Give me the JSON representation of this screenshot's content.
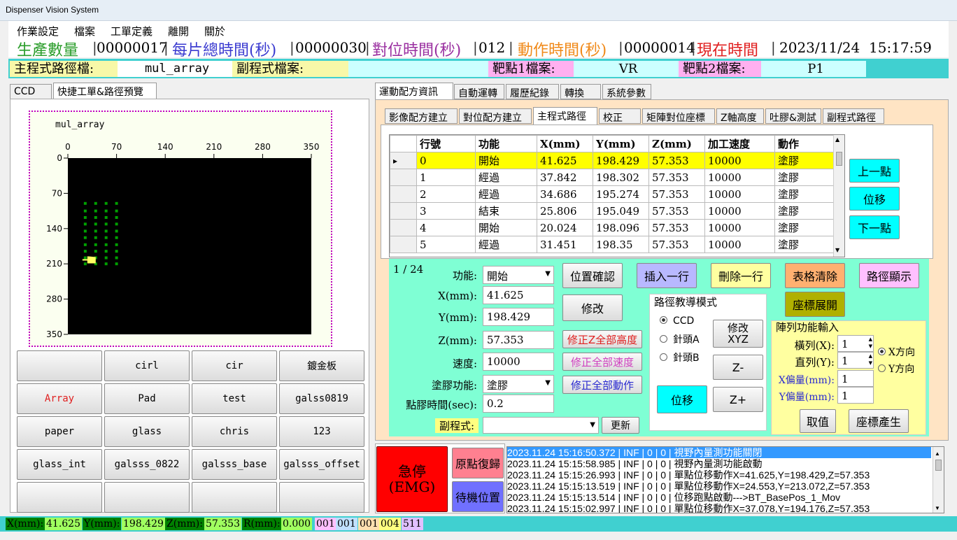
{
  "window": {
    "title": "Dispenser Vision System"
  },
  "menu": [
    "作業設定",
    "檔案",
    "工單定義",
    "離開",
    "關於"
  ],
  "info": {
    "prod_label": "生產數量",
    "prod_value": "00000017",
    "total_label": "每片總時間(秒)",
    "total_value": "00000030",
    "align_label": "對位時間(秒)",
    "align_value": "012",
    "action_label": "動作時間(秒)",
    "action_value": "00000014",
    "now_label": "現在時間",
    "now_value": "2023/11/24  15:17:59"
  },
  "paths": {
    "main_label": "主程式路徑檔:",
    "main_value": "mul_array",
    "sub_label": "副程式檔案:",
    "sub_value": "",
    "t1_label": "靶點1檔案:",
    "t1_value": "VR",
    "t2_label": "靶點2檔案:",
    "t2_value": "P1"
  },
  "left_tabs": [
    "CCD",
    "快捷工單&路徑預覽"
  ],
  "chart_data": {
    "type": "scatter",
    "title": "mul_array",
    "x_ticks": [
      "0",
      "70",
      "140",
      "210",
      "280",
      "350"
    ],
    "y_ticks": [
      "0",
      "70",
      "140",
      "210",
      "280",
      "350"
    ],
    "xlim": [
      0,
      350
    ],
    "ylim": [
      0,
      350
    ],
    "background": "#000000",
    "point_color": "#00a000",
    "points": [
      [
        25,
        90
      ],
      [
        40,
        90
      ],
      [
        55,
        90
      ],
      [
        70,
        90
      ],
      [
        25,
        105
      ],
      [
        40,
        105
      ],
      [
        55,
        105
      ],
      [
        70,
        105
      ],
      [
        25,
        118
      ],
      [
        40,
        118
      ],
      [
        55,
        118
      ],
      [
        70,
        118
      ],
      [
        25,
        131
      ],
      [
        40,
        131
      ],
      [
        55,
        131
      ],
      [
        70,
        131
      ],
      [
        25,
        145
      ],
      [
        40,
        145
      ],
      [
        55,
        145
      ],
      [
        70,
        145
      ],
      [
        25,
        158
      ],
      [
        40,
        158
      ],
      [
        55,
        158
      ],
      [
        70,
        158
      ],
      [
        25,
        172
      ],
      [
        40,
        172
      ],
      [
        55,
        172
      ],
      [
        70,
        172
      ],
      [
        25,
        185
      ],
      [
        40,
        185
      ],
      [
        55,
        185
      ],
      [
        70,
        185
      ],
      [
        25,
        198
      ],
      [
        40,
        198
      ],
      [
        55,
        198
      ],
      [
        70,
        198
      ],
      [
        25,
        210
      ],
      [
        40,
        210
      ],
      [
        55,
        210
      ],
      [
        70,
        210
      ]
    ],
    "marker": [
      33,
      202
    ]
  },
  "quick_buttons": [
    "",
    "cirl",
    "cir",
    "鍍金板",
    "Array",
    "Pad",
    "test",
    "galss0819",
    "paper",
    "glass",
    "chris",
    "123",
    "glass_int",
    "galsss_0822",
    "galsss_base",
    "galsss_offset",
    "",
    "",
    "",
    ""
  ],
  "main_tabs": [
    "運動配方資訊",
    "自動運轉",
    "履歷紀錄",
    "轉換",
    "系統參數"
  ],
  "sub_tabs": [
    "影像配方建立",
    "對位配方建立",
    "主程式路徑",
    "校正",
    "矩陣對位座標",
    "Z軸高度",
    "吐膠&測試",
    "副程式路徑"
  ],
  "grid": {
    "headers": [
      "行號",
      "功能",
      "X(mm)",
      "Y(mm)",
      "Z(mm)",
      "加工速度",
      "動作"
    ],
    "rows": [
      [
        "0",
        "開始",
        "41.625",
        "198.429",
        "57.353",
        "10000",
        "塗膠"
      ],
      [
        "1",
        "經過",
        "37.842",
        "198.302",
        "57.353",
        "10000",
        "塗膠"
      ],
      [
        "2",
        "經過",
        "34.686",
        "195.274",
        "57.353",
        "10000",
        "塗膠"
      ],
      [
        "3",
        "結束",
        "25.806",
        "195.049",
        "57.353",
        "10000",
        "塗膠"
      ],
      [
        "4",
        "開始",
        "20.024",
        "198.096",
        "57.353",
        "10000",
        "塗膠"
      ],
      [
        "5",
        "經過",
        "31.451",
        "198.35",
        "57.353",
        "10000",
        "塗膠"
      ]
    ]
  },
  "nav": {
    "prev": "上一點",
    "move": "位移",
    "next": "下一點"
  },
  "editor": {
    "counter": "1 / 24",
    "func_label": "功能:",
    "func_value": "開始",
    "x_label": "X(mm):",
    "x_value": "41.625",
    "y_label": "Y(mm):",
    "y_value": "198.429",
    "z_label": "Z(mm):",
    "z_value": "57.353",
    "speed_label": "速度:",
    "speed_value": "10000",
    "glue_label": "塗膠功能:",
    "glue_value": "塗膠",
    "dot_label": "點膠時間(sec):",
    "dot_value": "0.2",
    "sub_label": "副程式:",
    "sub_value": "",
    "refresh": "更新",
    "confirm": "位置確認",
    "modify": "修改",
    "fix_z": "修正Z全部高度",
    "fix_speed": "修正全部速度",
    "fix_action": "修正全部動作",
    "insert": "插入一行",
    "delete": "刪除一行",
    "clear": "表格清除",
    "show_path": "路徑顯示",
    "expand": "座標展開"
  },
  "teach": {
    "title": "路徑教導模式",
    "options": [
      "CCD",
      "針頭A",
      "針頭B"
    ],
    "selected": "CCD",
    "mod_xyz": "修改\nXYZ",
    "z_minus": "Z-",
    "z_plus": "Z+",
    "move": "位移"
  },
  "array": {
    "title": "陣列功能輸入",
    "cols_label": "橫列(X):",
    "cols_value": "1",
    "rows_label": "直列(Y):",
    "rows_value": "1",
    "xoff_label": "X偏量(mm):",
    "xoff_value": "1",
    "yoff_label": "Y偏量(mm):",
    "yoff_value": "1",
    "dir_x": "X方向",
    "dir_y": "Y方向",
    "selected": "X方向",
    "cancel": "取值",
    "generate": "座標產生"
  },
  "control": {
    "emg": "急停\n(EMG)",
    "home": "原點復歸",
    "standby": "待機位置"
  },
  "log": [
    "2023.11.24 15:16:50.372 | INF | 0 | 0 | 視野內量測功能關閉",
    "2023.11.24 15:15:58.985 | INF | 0 | 0 | 視野內量測功能啟動",
    "2023.11.24 15:15:26.993 | INF | 0 | 0 | 單點位移動作X=41.625,Y=198.429,Z=57.353",
    "2023.11.24 15:15:13.519 | INF | 0 | 0 | 單點位移動作X=24.553,Y=213.072,Z=57.353",
    "2023.11.24 15:15:13.514 | INF | 0 | 0 | 位移跑點啟動--->BT_BasePos_1_Mov",
    "2023.11.24 15:15:02.997 | INF | 0 | 0 | 單點位移動作X=37.078,Y=194.176,Z=57.353"
  ],
  "status": {
    "x_label": "X(mm):",
    "x_value": "41.625",
    "y_label": "Y(mm):",
    "y_value": "198.429",
    "z_label": "Z(mm):",
    "z_value": "57.353",
    "r_label": "R(mm):",
    "r_value": "0.000",
    "c1": "001",
    "c2": "001",
    "c3": "001",
    "c4": "004",
    "c5": "511"
  }
}
